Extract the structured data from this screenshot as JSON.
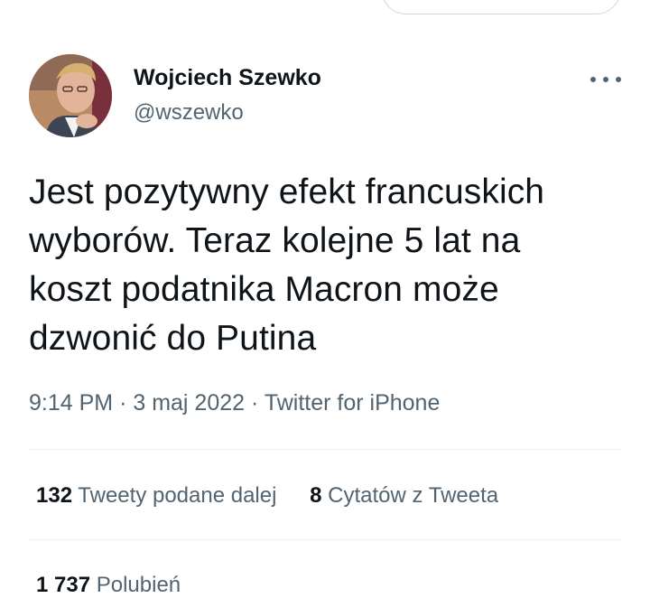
{
  "author": {
    "name": "Wojciech Szewko",
    "handle": "@wszewko"
  },
  "tweet": {
    "text_lines": [
      "Jest pozytywny efekt francuskich",
      "wyborów. Teraz kolejne 5 lat na",
      "koszt podatnika Macron może",
      "dzwonić do Putina"
    ],
    "time": "9:14 PM",
    "date": "3 maj 2022",
    "separator": "·",
    "source": "Twitter for iPhone"
  },
  "stats": {
    "retweets_count": "132",
    "retweets_label": "Tweety podane dalej",
    "quotes_count": "8",
    "quotes_label": "Cytatów z Tweeta",
    "likes_count": "1 737",
    "likes_label": "Polubień"
  },
  "icons": {
    "more": "more-horizontal-icon"
  },
  "colors": {
    "text_primary": "#0f1419",
    "text_secondary": "#536471",
    "divider": "#eff3f4"
  }
}
